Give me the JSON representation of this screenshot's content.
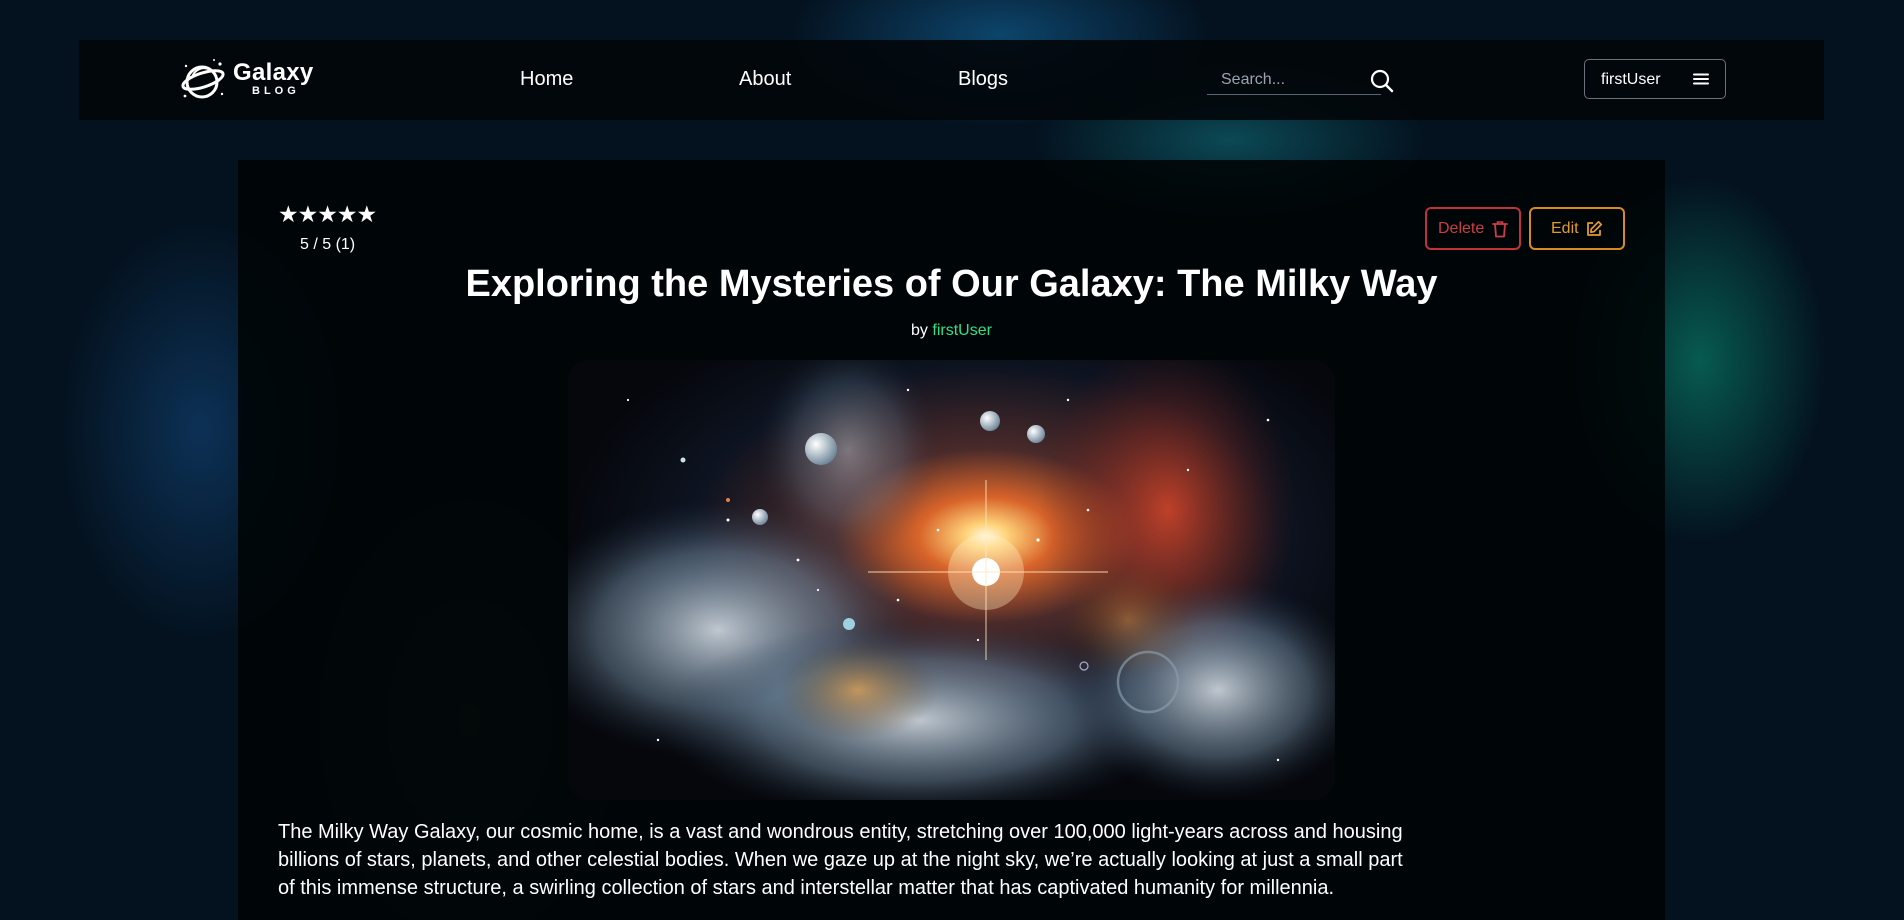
{
  "nav": {
    "logo_title": "Galaxy",
    "logo_sub": "BLOG",
    "links": [
      "Home",
      "About",
      "Blogs"
    ],
    "search_placeholder": "Search...",
    "username": "firstUser"
  },
  "post": {
    "rating_stars": 5,
    "rating_text": "5 / 5 (1)",
    "delete_label": "Delete",
    "edit_label": "Edit",
    "title": "Exploring the Mysteries of Our Galaxy: The Milky Way",
    "by": "by",
    "author": "firstUser",
    "body": "The Milky Way Galaxy, our cosmic home, is a vast and wondrous entity, stretching over 100,000 light-years across and housing billions of stars, planets, and other celestial bodies. When we gaze up at the night sky, we’re actually looking at just a small part of this immense structure, a swirling collection of stars and interstellar matter that has captivated humanity for millennia."
  },
  "colors": {
    "delete": "#c0313a",
    "edit": "#d98a1e",
    "author": "#2ee08a"
  },
  "icons": [
    "search-icon",
    "menu-icon",
    "trash-icon",
    "edit-icon",
    "star-icon"
  ]
}
